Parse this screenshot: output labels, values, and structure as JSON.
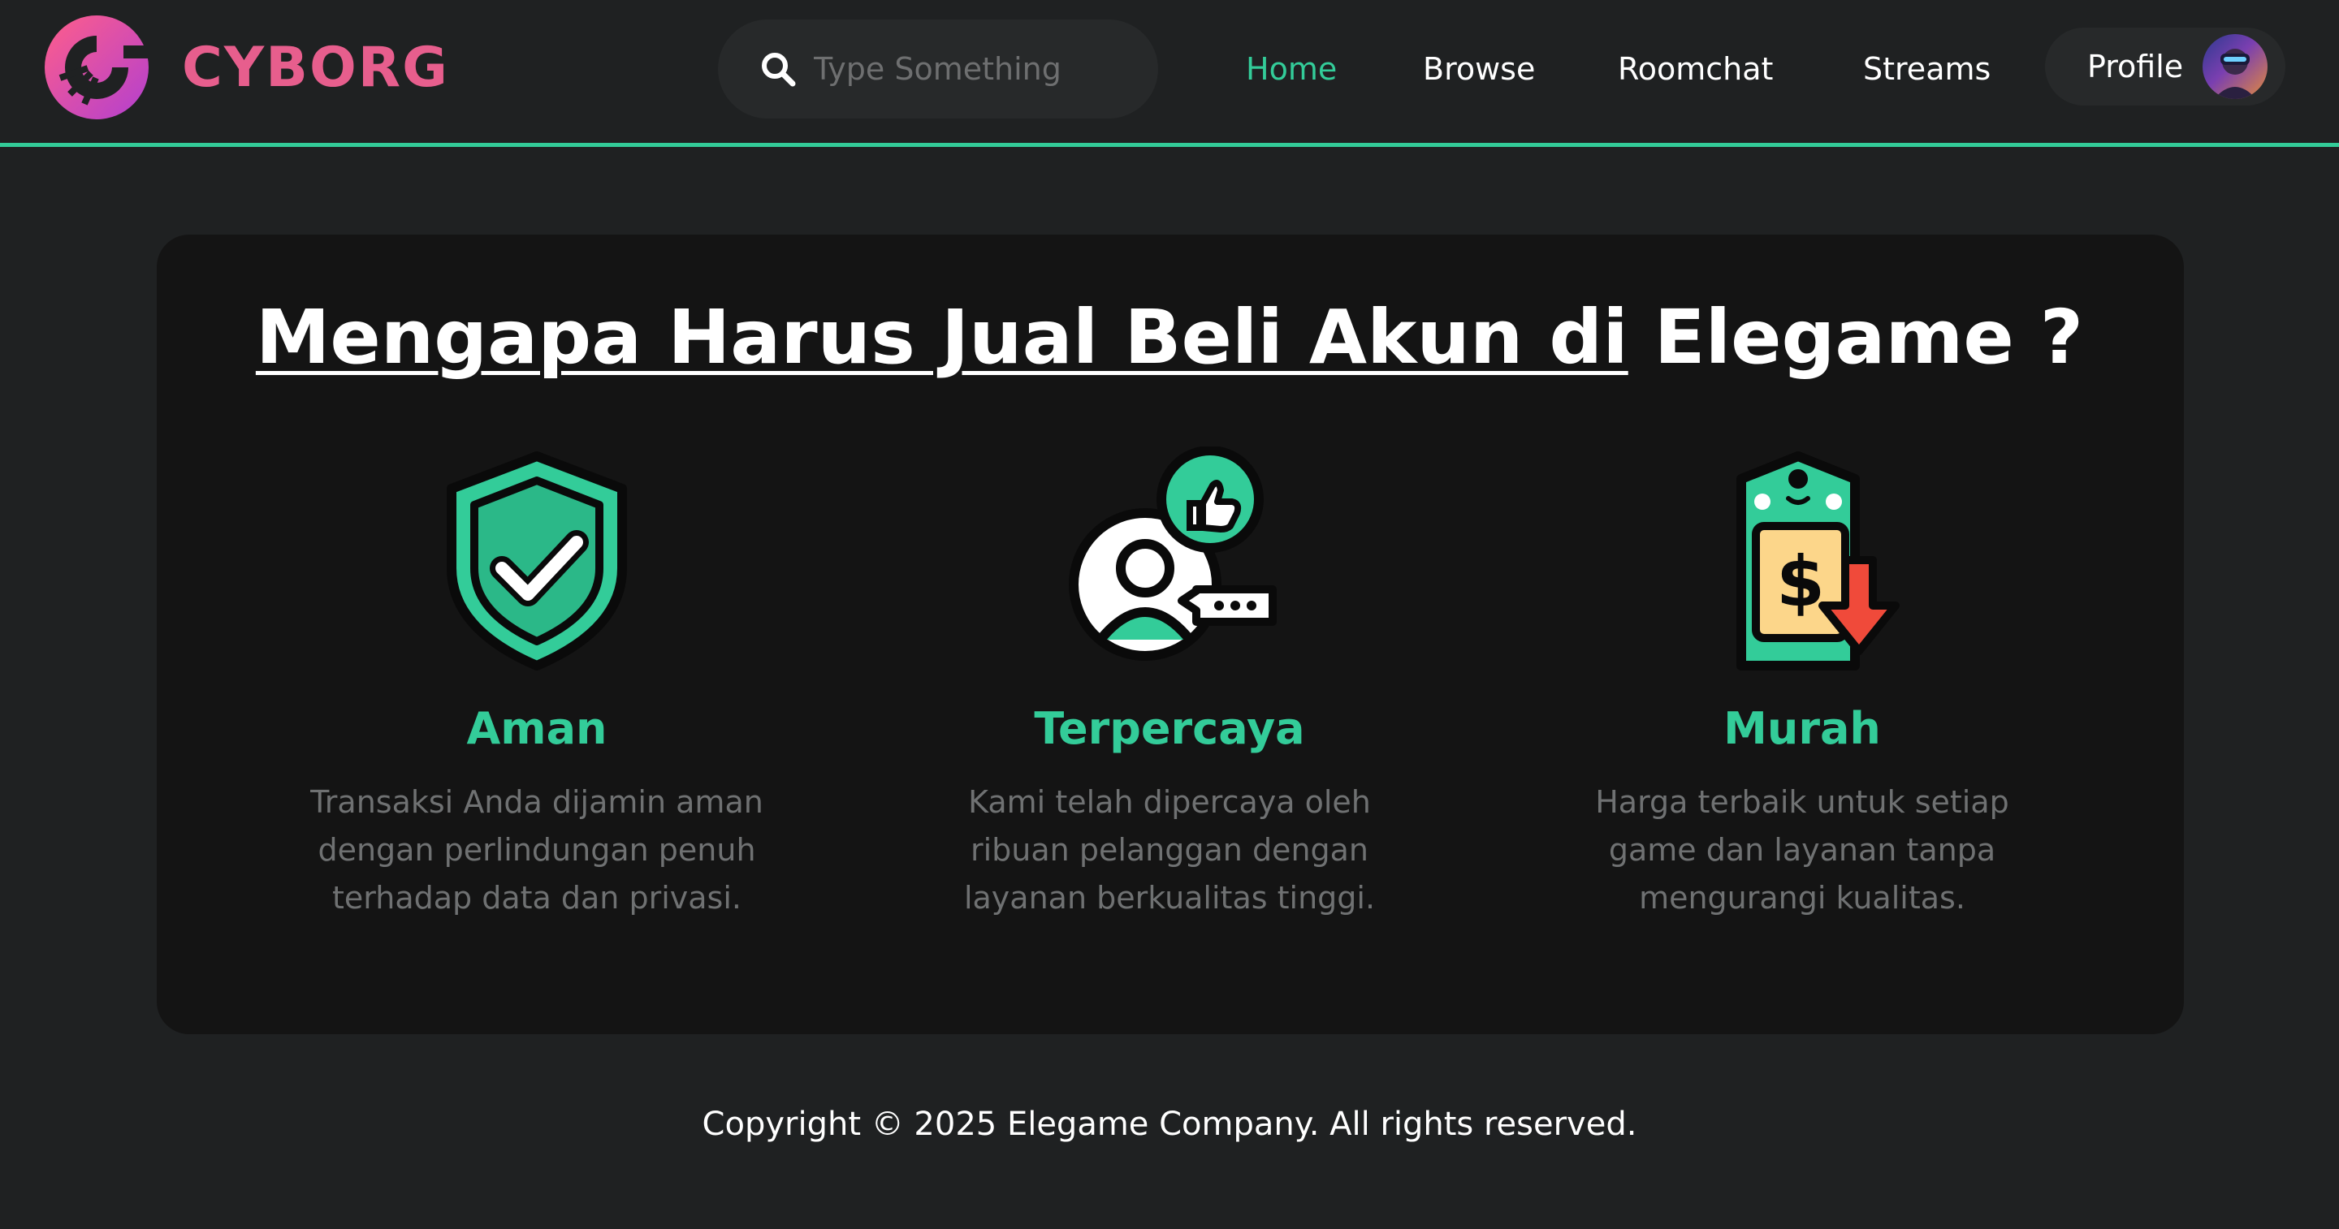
{
  "brand": {
    "name": "CYBORG",
    "accent_color": "#e75e8d"
  },
  "header": {
    "search": {
      "placeholder": "Type Something",
      "icon": "search-icon"
    },
    "nav": [
      {
        "label": "Home",
        "active": true
      },
      {
        "label": "Browse",
        "active": false
      },
      {
        "label": "Roomchat",
        "active": false
      },
      {
        "label": "Streams",
        "active": false
      }
    ],
    "profile": {
      "label": "Profile",
      "icon": "avatar"
    }
  },
  "main": {
    "heading_underlined": "Mengapa Harus Jual Beli Akun di",
    "heading_rest": " Elegame ?",
    "features": [
      {
        "icon": "shield-check-icon",
        "title": "Aman",
        "description": "Transaksi Anda dijamin aman dengan perlindungan penuh terhadap data dan privasi."
      },
      {
        "icon": "trusted-user-thumbs-up-icon",
        "title": "Terpercaya",
        "description": "Kami telah dipercaya oleh ribuan pelanggan dengan layanan berkualitas tinggi."
      },
      {
        "icon": "price-tag-down-icon",
        "title": "Murah",
        "description": "Harga terbaik untuk setiap game dan layanan tanpa mengurangi kualitas."
      }
    ]
  },
  "footer": {
    "copyright": "Copyright © 2025 Elegame Company. All rights reserved."
  },
  "colors": {
    "background": "#1f2122",
    "card": "#141414",
    "accent_green": "#33cc99",
    "muted_text": "#6f7172"
  }
}
